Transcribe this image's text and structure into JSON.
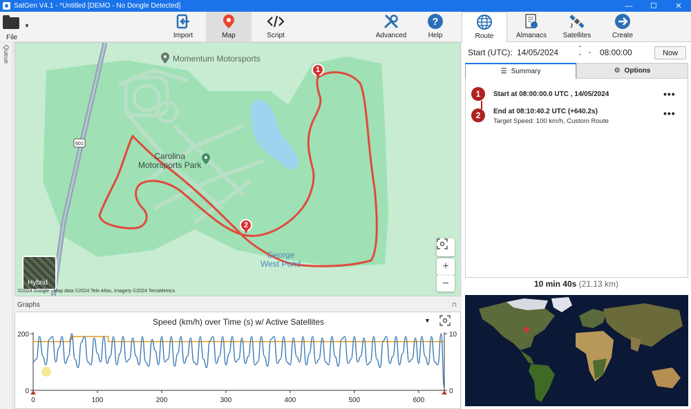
{
  "titlebar": {
    "title": "SatGen V4.1 - *Untitled [DEMO - No Dongle Detected]",
    "min": "—",
    "max": "☐",
    "close": "✕"
  },
  "ribbon": {
    "file": "File",
    "import": "Import",
    "map": "Map",
    "script": "Script",
    "advanced": "Advanced",
    "help": "Help"
  },
  "right_tabs": {
    "route": "Route",
    "almanacs": "Almanacs",
    "satellites": "Satellites",
    "create": "Create"
  },
  "queue_label": "Queue",
  "map": {
    "poi_momentum": "Momentum Motorsports",
    "poi_carolina_line1": "Carolina",
    "poi_carolina_line2": "Motorsports Park",
    "lake_line1": "George",
    "lake_line2": "West Pond",
    "road_shield": "601",
    "hybrid": "Hybrid",
    "attribution": "©2024 Google · Map data ©2024 Tele Atlas, Imagery ©2024 TerraMetrics",
    "zoom_in": "+",
    "zoom_out": "−",
    "marker1": "1",
    "marker2": "2"
  },
  "graphs": {
    "header": "Graphs",
    "pin": "📌"
  },
  "chart_data": {
    "type": "line",
    "title": "Speed (km/h) over Time (s) w/ Active Satellites",
    "x_ticks": [
      "0",
      "100",
      "200",
      "300",
      "400",
      "500",
      "600"
    ],
    "y_left_ticks": [
      "0",
      "200"
    ],
    "y_right_ticks": [
      "0",
      "10"
    ],
    "xlim": [
      0,
      640
    ],
    "ylim_left": [
      0,
      200
    ],
    "ylim_right": [
      0,
      10
    ],
    "series": [
      {
        "name": "Speed",
        "color": "#3c78b4",
        "x": [
          0,
          5,
          10,
          15,
          20,
          25,
          30,
          35,
          40,
          45,
          50,
          55,
          60,
          65,
          70,
          75,
          80,
          85,
          90,
          95,
          100,
          105,
          110,
          115,
          120,
          125,
          130,
          135,
          140,
          145,
          150,
          155,
          160,
          165,
          170,
          175,
          180,
          185,
          190,
          195,
          200,
          205,
          210,
          215,
          220,
          225,
          230,
          235,
          240,
          245,
          250,
          255,
          260,
          265,
          270,
          275,
          280,
          285,
          290,
          295,
          300,
          305,
          310,
          315,
          320,
          325,
          330,
          335,
          340,
          345,
          350,
          355,
          360,
          365,
          370,
          375,
          380,
          385,
          390,
          395,
          400,
          405,
          410,
          415,
          420,
          425,
          430,
          435,
          440,
          445,
          450,
          455,
          460,
          465,
          470,
          475,
          480,
          485,
          490,
          495,
          500,
          505,
          510,
          515,
          520,
          525,
          530,
          535,
          540,
          545,
          550,
          555,
          560,
          565,
          570,
          575,
          580,
          585,
          590,
          595,
          600,
          605,
          610,
          615,
          620,
          625,
          630,
          635,
          640
        ],
        "values": [
          100,
          110,
          190,
          120,
          90,
          180,
          190,
          100,
          150,
          190,
          95,
          120,
          200,
          110,
          80,
          170,
          190,
          100,
          90,
          185,
          130,
          100,
          190,
          95,
          120,
          190,
          90,
          130,
          190,
          100,
          110,
          185,
          120,
          90,
          190,
          100,
          85,
          180,
          140,
          90,
          190,
          100,
          110,
          190,
          85,
          130,
          190,
          95,
          120,
          185,
          100,
          90,
          190,
          110,
          80,
          175,
          190,
          95,
          120,
          190,
          90,
          130,
          190,
          100,
          110,
          185,
          95,
          120,
          190,
          90,
          100,
          190,
          120,
          85,
          180,
          190,
          95,
          110,
          190,
          100,
          90,
          185,
          120,
          100,
          190,
          90,
          130,
          190,
          95,
          110,
          185,
          100,
          90,
          190,
          120,
          85,
          180,
          190,
          95,
          110,
          190,
          100,
          120,
          185,
          90,
          100,
          190,
          110,
          80,
          175,
          190,
          95,
          120,
          190,
          90,
          130,
          190,
          100,
          110,
          185,
          95,
          190,
          120,
          90,
          190,
          100,
          90,
          200,
          10
        ]
      },
      {
        "name": "Active Satellites",
        "color": "#e89a1c",
        "x": [
          0,
          57,
          57,
          60,
          60,
          117,
          117,
          640
        ],
        "values": [
          8.6,
          8.6,
          9,
          9,
          9.5,
          9.5,
          8.6,
          8.6
        ]
      }
    ],
    "grid": false
  },
  "route_panel": {
    "start_label": "Start (UTC):",
    "date": "14/05/2024",
    "time": "08:00:00",
    "now": "Now",
    "tab_summary": "Summary",
    "tab_options": "Options",
    "wp1_num": "1",
    "wp1_main": "Start at 08:00:00.0 UTC , 14/05/2024",
    "wp2_num": "2",
    "wp2_main": "End at 08:10:40.2 UTC (+640.2s)",
    "wp2_sub": "Target Speed: 100 km/h, Custom Route",
    "more": "•••",
    "duration": "10 min 40s",
    "distance": "(21.13 km)"
  },
  "colors": {
    "accent": "#1a73e8",
    "route": "#e04a3c",
    "marker": "#b02121",
    "map_bg": "#c7ecd2",
    "park": "#9fe0b5",
    "water": "#9ed4ee"
  }
}
